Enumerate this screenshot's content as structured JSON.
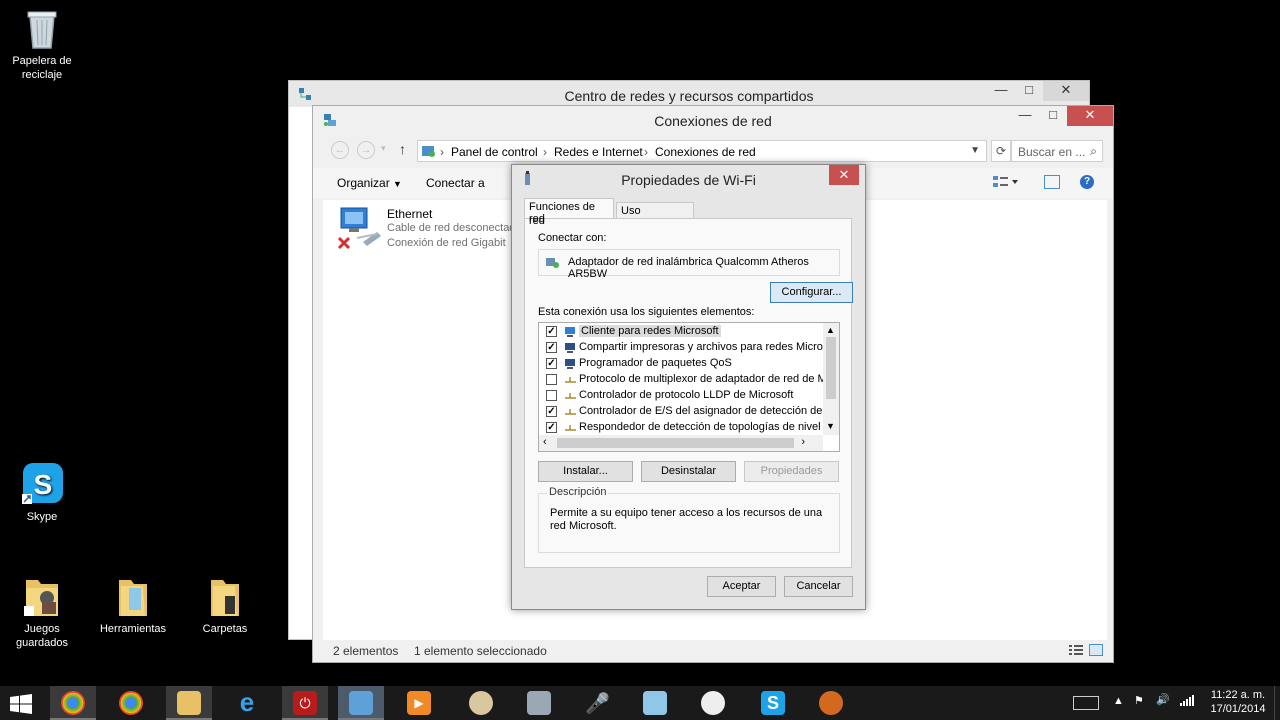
{
  "desktop": {
    "icons": [
      {
        "label": "Papelera de reciclaje"
      },
      {
        "label": "Skype"
      },
      {
        "label": "Juegos guardados"
      },
      {
        "label": "Herramientas"
      },
      {
        "label": "Carpetas"
      }
    ]
  },
  "back_window": {
    "title": "Centro de redes y recursos compartidos"
  },
  "main_window": {
    "title": "Conexiones de red",
    "breadcrumb": [
      "Panel de control",
      "Redes e Internet",
      "Conexiones de red"
    ],
    "search_placeholder": "Buscar en ...",
    "toolbar": {
      "organize": "Organizar",
      "connect_to": "Conectar a"
    },
    "item": {
      "name": "Ethernet",
      "status": "Cable de red desconectado",
      "device": "Conexión de red Gigabit"
    },
    "status": {
      "count": "2 elementos",
      "selected": "1 elemento seleccionado"
    }
  },
  "dialog": {
    "title": "Propiedades de Wi-Fi",
    "tabs": [
      "Funciones de red",
      "Uso compartido"
    ],
    "connect_with_label": "Conectar con:",
    "adapter": "Adaptador de red inalámbrica Qualcomm Atheros AR5BW",
    "configure_button": "Configurar...",
    "elements_label": "Esta conexión usa los siguientes elementos:",
    "items": [
      {
        "label": "Cliente para redes Microsoft",
        "checked": true,
        "selected": true
      },
      {
        "label": "Compartir impresoras y archivos para redes Microsoft",
        "checked": true
      },
      {
        "label": "Programador de paquetes QoS",
        "checked": true
      },
      {
        "label": "Protocolo de multiplexor de adaptador de red de Micros",
        "checked": false
      },
      {
        "label": "Controlador de protocolo LLDP de Microsoft",
        "checked": false
      },
      {
        "label": "Controlador de E/S del asignador de detección de topo",
        "checked": true
      },
      {
        "label": "Respondedor de detección de topologías de nivel de v",
        "checked": true
      }
    ],
    "install_button": "Instalar...",
    "uninstall_button": "Desinstalar",
    "properties_button": "Propiedades",
    "description_title": "Descripción",
    "description_text": "Permite a su equipo tener acceso a los recursos de una red Microsoft.",
    "ok_button": "Aceptar",
    "cancel_button": "Cancelar"
  },
  "taskbar": {
    "clock_time": "11:22 a. m.",
    "clock_date": "17/01/2014"
  },
  "colors": {
    "close_red": "#c75050",
    "taskbar": "#1a1a1a",
    "accent_blue": "#3c7fb1"
  }
}
